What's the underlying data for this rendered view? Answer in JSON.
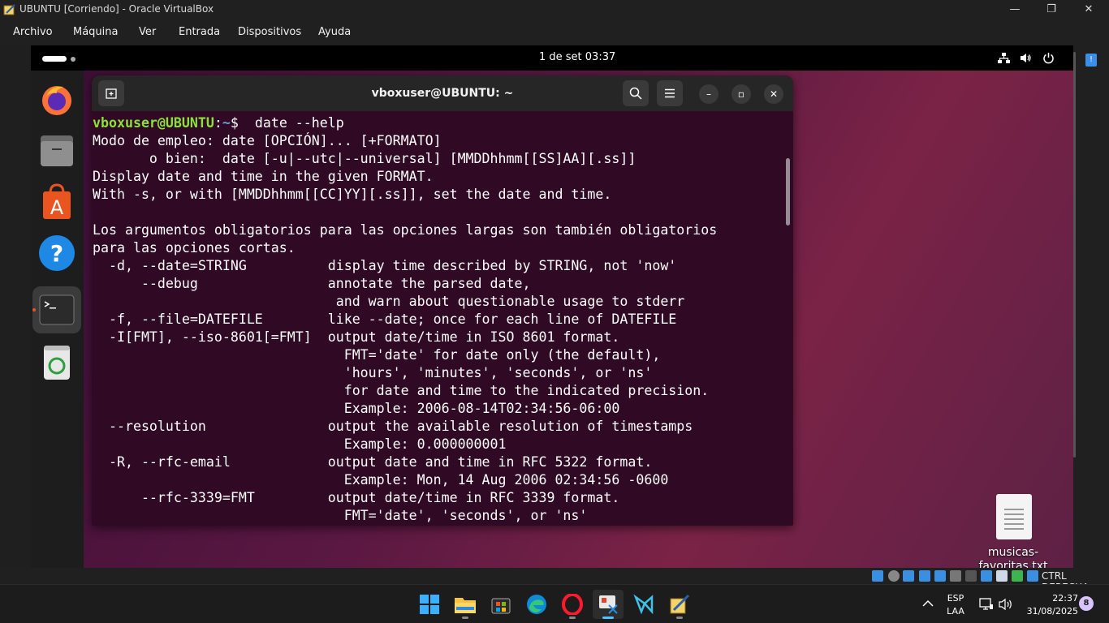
{
  "vbox": {
    "window_title": "UBUNTU [Corriendo] - Oracle VirtualBox",
    "menu": [
      "Archivo",
      "Máquina",
      "Ver",
      "Entrada",
      "Dispositivos",
      "Ayuda"
    ],
    "host_key": "CTRL DERECHA"
  },
  "ubuntu": {
    "clock": "1 de set  03:37",
    "dock_apps": [
      "firefox-icon",
      "files-icon",
      "app-center-icon",
      "help-icon",
      "terminal-icon",
      "trash-icon"
    ],
    "desktop_file": "musicas-favoritas.txt"
  },
  "terminal": {
    "title": "vboxuser@UBUNTU: ~",
    "prompt_user": "vboxuser@UBUNTU",
    "prompt_sep": ":",
    "prompt_path": "~",
    "prompt_symbol": "$  ",
    "command": "date --help",
    "lines": [
      "Modo de empleo: date [OPCIÓN]... [+FORMATO]",
      "       o bien:  date [-u|--utc|--universal] [MMDDhhmm[[SS]AA][.ss]]",
      "Display date and time in the given FORMAT.",
      "With -s, or with [MMDDhhmm[[CC]YY][.ss]], set the date and time.",
      "",
      "Los argumentos obligatorios para las opciones largas son también obligatorios",
      "para las opciones cortas.",
      "  -d, --date=STRING          display time described by STRING, not 'now'",
      "      --debug                annotate the parsed date,",
      "                              and warn about questionable usage to stderr",
      "  -f, --file=DATEFILE        like --date; once for each line of DATEFILE",
      "  -I[FMT], --iso-8601[=FMT]  output date/time in ISO 8601 format.",
      "                               FMT='date' for date only (the default),",
      "                               'hours', 'minutes', 'seconds', or 'ns'",
      "                               for date and time to the indicated precision.",
      "                               Example: 2006-08-14T02:34:56-06:00",
      "  --resolution               output the available resolution of timestamps",
      "                               Example: 0.000000001",
      "  -R, --rfc-email            output date and time in RFC 5322 format.",
      "                               Example: Mon, 14 Aug 2006 02:34:56 -0600",
      "      --rfc-3339=FMT         output date/time in RFC 3339 format.",
      "                               FMT='date', 'seconds', or 'ns'"
    ]
  },
  "taskbar": {
    "language": "ESP",
    "layout": "LAA",
    "time": "22:37",
    "date": "31/08/2025",
    "notifications": "8"
  }
}
